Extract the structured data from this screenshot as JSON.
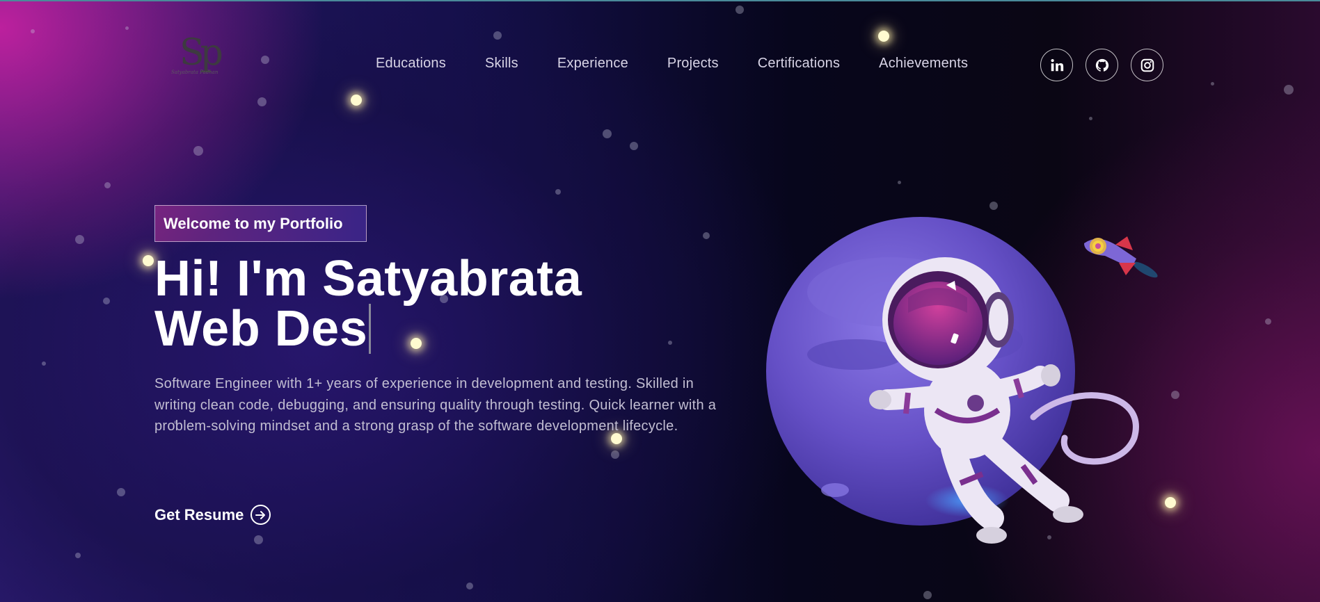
{
  "logo": {
    "mark": "Sp",
    "signature": "Satyabrata Padhan",
    "label": "site-logo"
  },
  "nav": {
    "items": [
      {
        "label": "Educations"
      },
      {
        "label": "Skills"
      },
      {
        "label": "Experience"
      },
      {
        "label": "Projects"
      },
      {
        "label": "Certifications"
      },
      {
        "label": "Achievements"
      }
    ]
  },
  "socials": [
    {
      "icon": "linkedin-icon"
    },
    {
      "icon": "github-icon"
    },
    {
      "icon": "instagram-icon"
    }
  ],
  "hero": {
    "badge": "Welcome to my Portfolio",
    "headline_line1": "Hi! I'm Satyabrata",
    "headline_line2": "Web Des",
    "description": "Software Engineer with 1+ years of experience in development and testing. Skilled in writing clean code, debugging, and ensuring quality through testing. Quick learner with a problem-solving mindset and a strong grasp of the software development lifecycle.",
    "cta_label": "Get Resume"
  },
  "illustration": {
    "subject": "astronaut-planet-illustration",
    "rocket": "rocket-illustration"
  },
  "colors": {
    "accent_magenta": "#c421a0",
    "deep_navy": "#15104c",
    "planet_purple": "#6a55c8",
    "text_muted": "#c2bed2"
  }
}
